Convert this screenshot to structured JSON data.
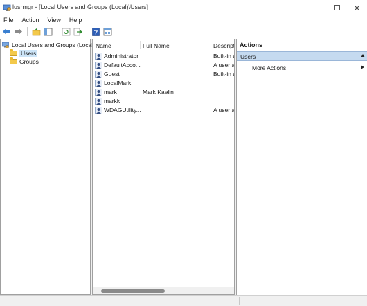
{
  "window": {
    "title": "lusrmgr - [Local Users and Groups (Local)\\Users]",
    "icon": "computer-management-icon"
  },
  "menu": [
    "File",
    "Action",
    "View",
    "Help"
  ],
  "toolbar": {
    "icons": [
      "back-arrow-icon",
      "forward-arrow-icon",
      "up-folder-icon",
      "show-hide-tree-icon",
      "refresh-icon",
      "export-list-icon",
      "help-icon",
      "properties-icon"
    ]
  },
  "tree": {
    "root": "Local Users and Groups (Local)",
    "children": [
      "Users",
      "Groups"
    ],
    "selected": "Users"
  },
  "list": {
    "columns": [
      "Name",
      "Full Name",
      "Descripti"
    ],
    "rows": [
      {
        "name": "Administrator",
        "full_name": "",
        "description": "Built-in a"
      },
      {
        "name": "DefaultAcco...",
        "full_name": "",
        "description": "A user ac"
      },
      {
        "name": "Guest",
        "full_name": "",
        "description": "Built-in a"
      },
      {
        "name": "LocalMark",
        "full_name": "",
        "description": ""
      },
      {
        "name": "mark",
        "full_name": "Mark Kaelin",
        "description": ""
      },
      {
        "name": "markk",
        "full_name": "",
        "description": ""
      },
      {
        "name": "WDAGUtility...",
        "full_name": "",
        "description": "A user ac"
      }
    ]
  },
  "actions": {
    "title": "Actions",
    "section": "Users",
    "items": [
      "More Actions"
    ]
  },
  "colors": {
    "selection": "#cce4f7",
    "actions_header": "#c5daf0",
    "folder": "#f3c94b"
  }
}
